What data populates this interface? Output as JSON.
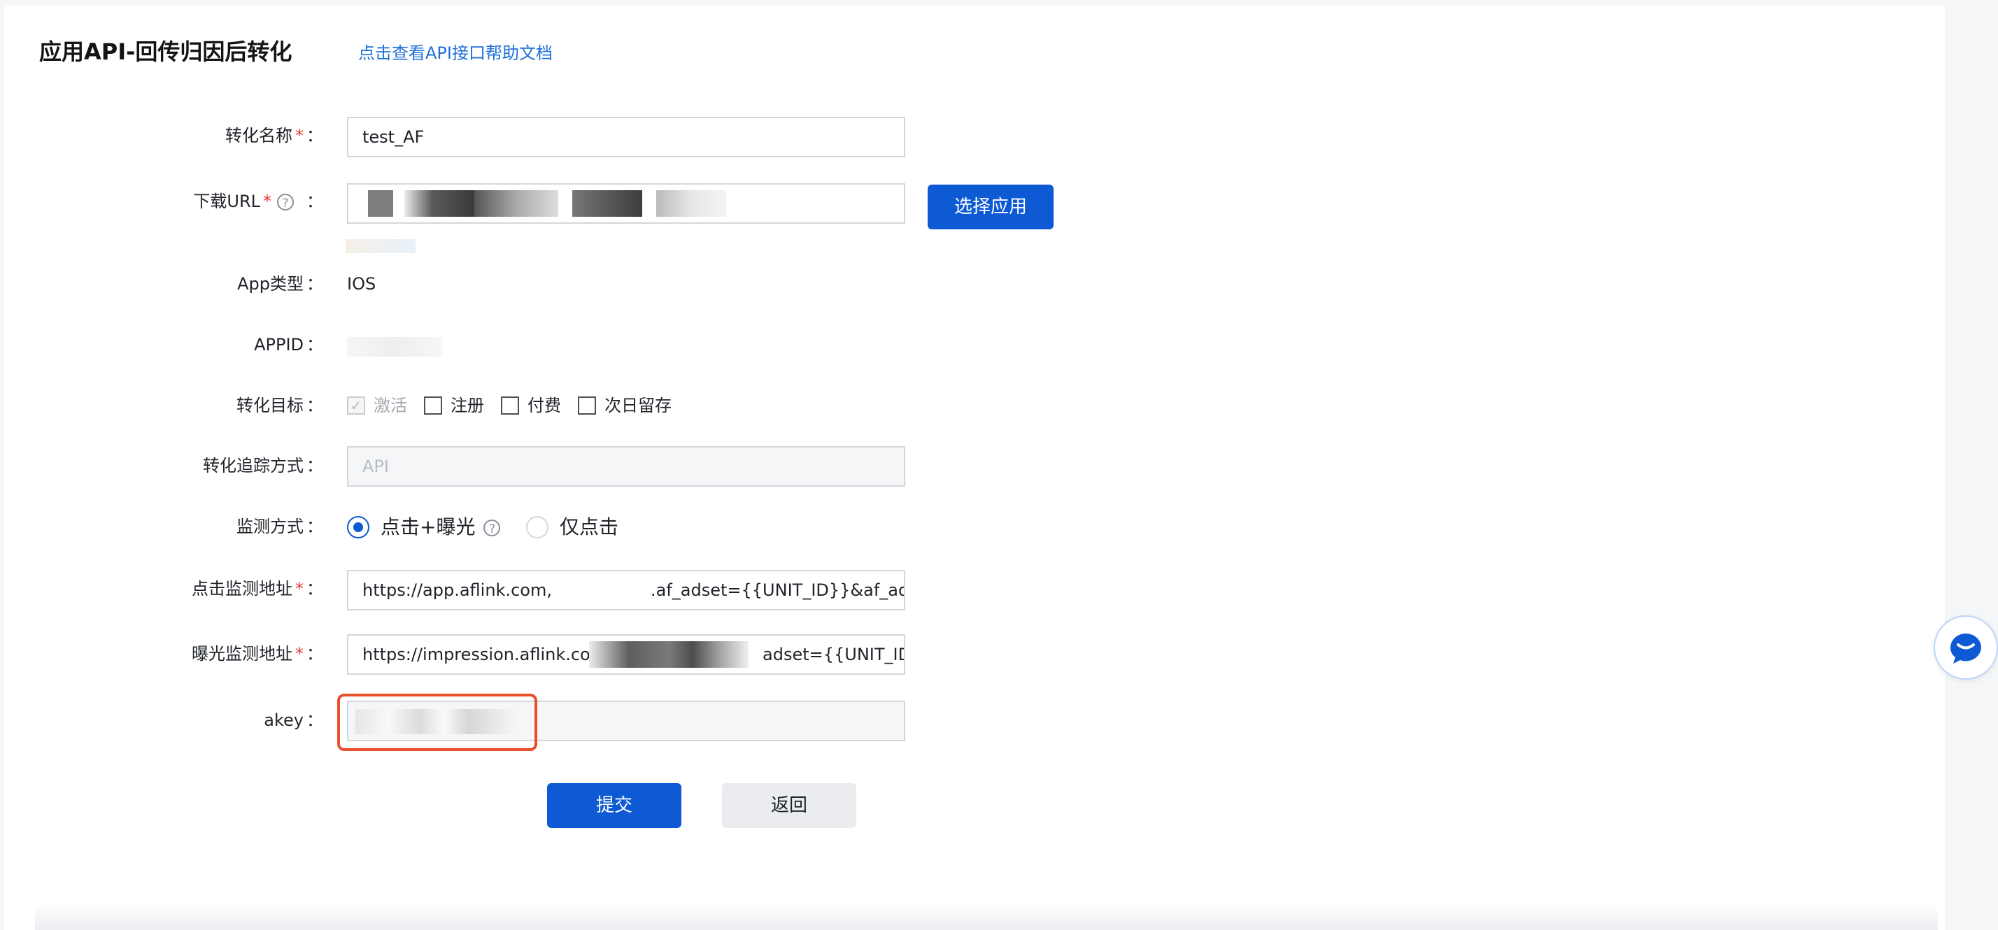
{
  "header": {
    "title": "应用API-回传归因后转化",
    "help_link": "点击查看API接口帮助文档"
  },
  "form": {
    "conversion_name": {
      "label": "转化名称",
      "value": "test_AF"
    },
    "download_url": {
      "label": "下载URL",
      "help": "?",
      "button": "选择应用"
    },
    "app_type": {
      "label": "App类型",
      "value": "IOS"
    },
    "appid": {
      "label": "APPID"
    },
    "conversion_goal": {
      "label": "转化目标",
      "options": [
        "激活",
        "注册",
        "付费",
        "次日留存"
      ]
    },
    "tracking_method": {
      "label": "转化追踪方式",
      "value": "API"
    },
    "monitor_method": {
      "label": "监测方式",
      "options": [
        "点击+曝光",
        "仅点击"
      ],
      "help": "?"
    },
    "click_url": {
      "label": "点击监测地址",
      "prefix": "https://app.aflink.com,",
      "suffix": ".af_adset={{UNIT_ID}}&af_ad={"
    },
    "impression_url": {
      "label": "曝光监测地址",
      "prefix": "https://impression.aflink.con",
      "suffix": "adset={{UNIT_ID}}&a"
    },
    "akey": {
      "label": "akey"
    },
    "colon": "：",
    "required_mark": "*"
  },
  "actions": {
    "submit": "提交",
    "back": "返回"
  },
  "colors": {
    "primary": "#0d5ad4",
    "highlight": "#e8502a",
    "required": "#e53935"
  }
}
